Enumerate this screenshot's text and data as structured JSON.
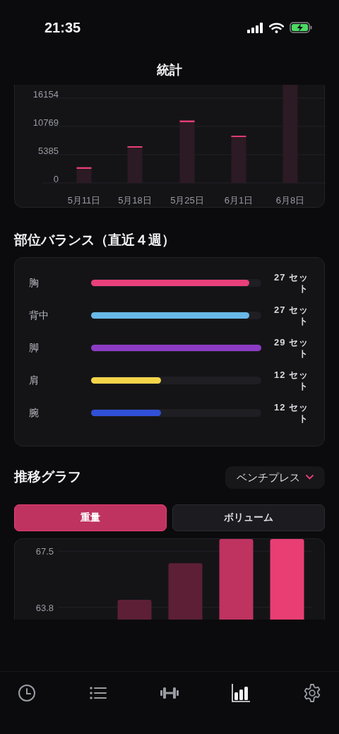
{
  "status_bar": {
    "time": "21:35"
  },
  "header": {
    "title": "統計"
  },
  "weekly_chart": {
    "chart_data": {
      "type": "bar",
      "categories": [
        "5月11日",
        "5月18日",
        "5月25日",
        "6月1日",
        "6月8日"
      ],
      "values": [
        3000,
        7000,
        11900,
        9000,
        18700
      ],
      "ylim": [
        0,
        18700
      ],
      "grid": true,
      "yticks": [
        0,
        5385,
        10769,
        16154
      ]
    }
  },
  "balance": {
    "title": "部位バランス（直近４週）",
    "parts": [
      {
        "name": "胸",
        "level": 0.93,
        "reading": "27 セット",
        "color": "#e8407a"
      },
      {
        "name": "背中",
        "level": 0.93,
        "reading": "27 セット",
        "color": "#68b8e8"
      },
      {
        "name": "脚",
        "level": 1,
        "reading": "29 セット",
        "color": "#8c3cc4"
      },
      {
        "name": "肩",
        "level": 0.41,
        "reading": "12 セット",
        "color": "#f5d44a"
      },
      {
        "name": "腕",
        "level": 0.41,
        "reading": "12 セット",
        "color": "#3050d8"
      }
    ]
  },
  "trend": {
    "title": "推移グラフ",
    "exercise_select": {
      "value": "ベンチプレス"
    },
    "modes": [
      {
        "label": "重量",
        "selected": true
      },
      {
        "label": "ボリューム",
        "selected": false
      }
    ],
    "chart_data": {
      "type": "bar",
      "stacked": true,
      "series": [
        {
          "color": "#5c1f36",
          "values": [
            null,
            64.3,
            66.7,
            null,
            null
          ]
        },
        {
          "color": "#bf3361",
          "values": [
            null,
            null,
            null,
            68.3,
            null
          ]
        },
        {
          "color": "#e83e74",
          "values": [
            null,
            null,
            null,
            null,
            68.3
          ]
        }
      ],
      "ylim": [
        62.9,
        68.3
      ],
      "yticks": [
        63.8,
        67.5
      ]
    }
  },
  "tab_bar": [
    {
      "kind": "history",
      "selected": false
    },
    {
      "kind": "list",
      "selected": false
    },
    {
      "kind": "dumbbell",
      "selected": false
    },
    {
      "kind": "stats",
      "selected": true
    },
    {
      "kind": "settings",
      "selected": false
    }
  ]
}
